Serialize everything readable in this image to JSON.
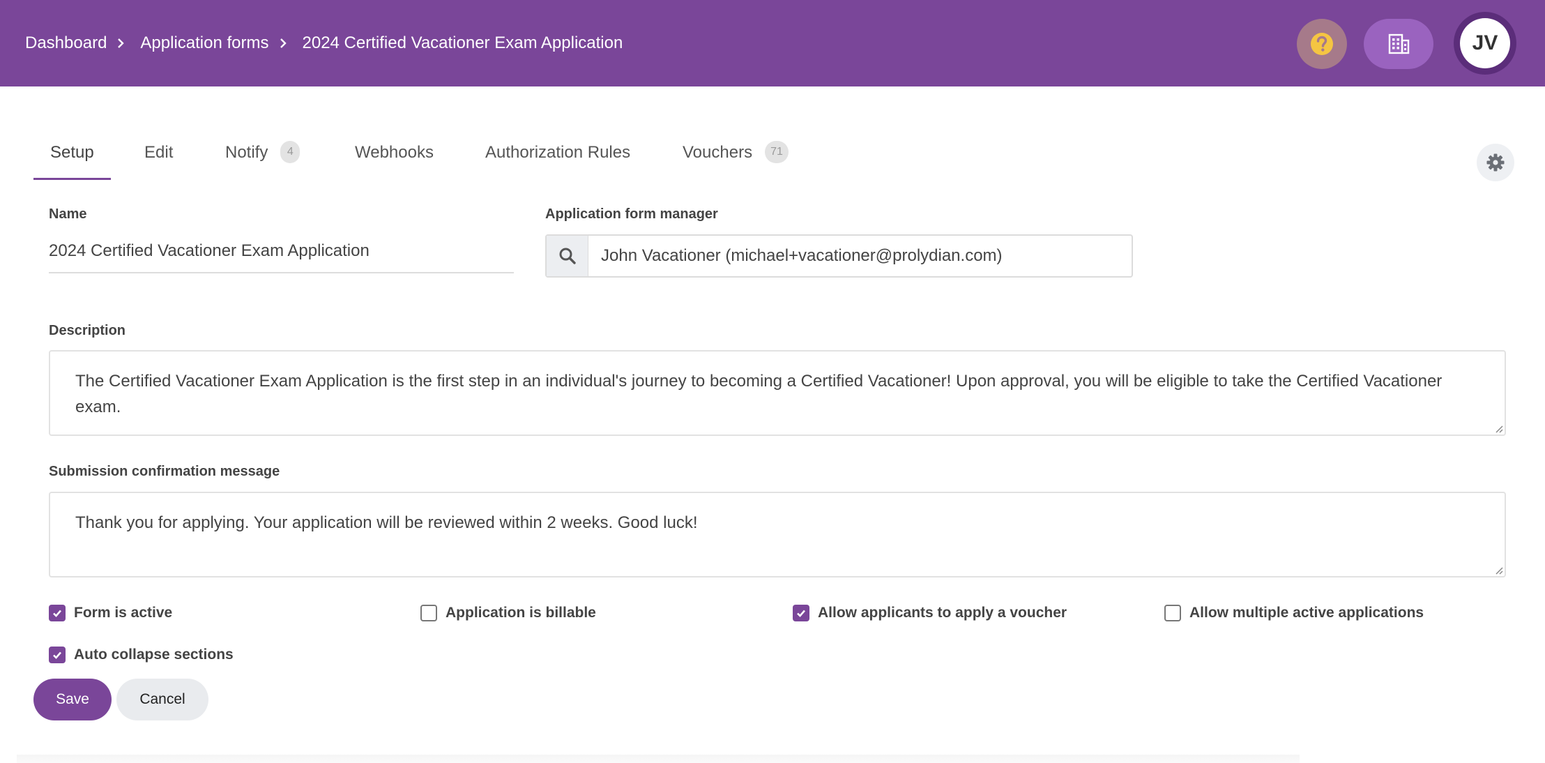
{
  "breadcrumb": {
    "items": [
      "Dashboard",
      "Application forms",
      "2024 Certified Vacationer Exam Application"
    ]
  },
  "header": {
    "help_icon": "question-circle-icon",
    "org_icon": "building-icon",
    "avatar_initials": "JV",
    "colors": {
      "bar": "#7a4699",
      "help_icon": "#f5c542"
    }
  },
  "tabs": [
    {
      "label": "Setup",
      "active": true
    },
    {
      "label": "Edit"
    },
    {
      "label": "Notify",
      "badge": "4"
    },
    {
      "label": "Webhooks"
    },
    {
      "label": "Authorization Rules"
    },
    {
      "label": "Vouchers",
      "badge": "71"
    }
  ],
  "form": {
    "name_label": "Name",
    "name_value": "2024 Certified Vacationer Exam Application",
    "manager_label": "Application form manager",
    "manager_value": "John Vacationer (michael+vacationer@prolydian.com)",
    "description_label": "Description",
    "description_value": "The Certified Vacationer Exam Application is the first step in an individual's journey to becoming a Certified Vacationer! Upon approval, you will be eligible to take the Certified Vacationer exam.",
    "confirmation_label": "Submission confirmation message",
    "confirmation_value": "Thank you for applying. Your application will be reviewed within 2 weeks. Good luck!",
    "checkboxes": [
      {
        "label": "Form is active",
        "checked": true
      },
      {
        "label": "Application is billable",
        "checked": false
      },
      {
        "label": "Allow applicants to apply a voucher",
        "checked": true
      },
      {
        "label": "Allow multiple active applications",
        "checked": false
      },
      {
        "label": "Auto collapse sections",
        "checked": true
      }
    ],
    "save_label": "Save",
    "cancel_label": "Cancel"
  }
}
